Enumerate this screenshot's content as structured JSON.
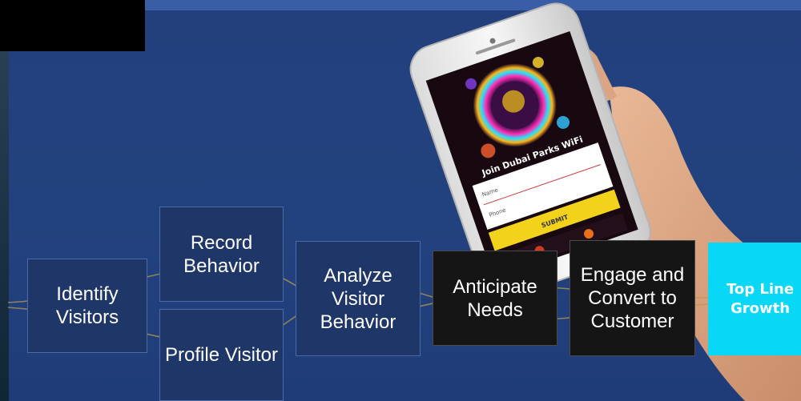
{
  "diagram": {
    "steps": [
      {
        "id": "identify",
        "label": "Identify Visitors"
      },
      {
        "id": "record",
        "label": "Record Behavior"
      },
      {
        "id": "profile",
        "label": "Profile Visitor"
      },
      {
        "id": "analyze",
        "label": "Analyze Visitor Behavior"
      },
      {
        "id": "anticipate",
        "label": "Anticipate Needs"
      },
      {
        "id": "engage",
        "label": "Engage and Convert to Customer"
      },
      {
        "id": "topline",
        "label": "Top Line Growth"
      }
    ]
  },
  "phone": {
    "join_text": "Join Dubai Parks WiFi",
    "name_placeholder": "Name",
    "phone_placeholder": "Phone",
    "submit_label": "SUBMIT"
  },
  "colors": {
    "background": "#23407d",
    "box_blue": "#1f3668",
    "box_dark": "#151515",
    "accent_cyan": "#08d8f6",
    "submit_yellow": "#f2d21a"
  }
}
